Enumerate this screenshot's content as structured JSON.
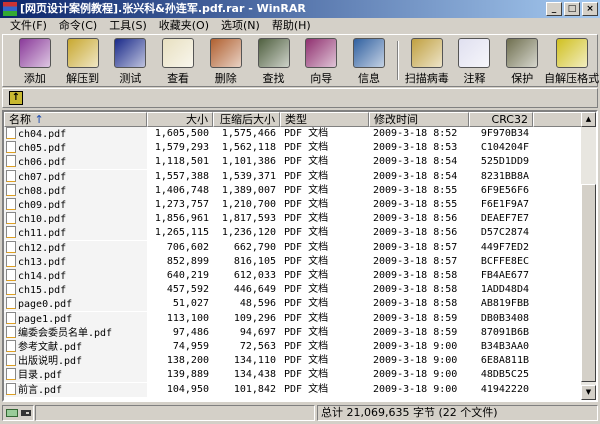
{
  "window": {
    "title": "[网页设计案例教程].张兴科&孙连军.pdf.rar - WinRAR",
    "min": "_",
    "max": "□",
    "close": "×"
  },
  "menu": [
    "文件(F)",
    "命令(C)",
    "工具(S)",
    "收藏夹(O)",
    "选项(N)",
    "帮助(H)"
  ],
  "toolbar": [
    {
      "label": "添加",
      "icon": "add-archive-icon",
      "color": "#8a3a9a"
    },
    {
      "label": "解压到",
      "icon": "extract-to-icon",
      "color": "#c8a830"
    },
    {
      "label": "测试",
      "icon": "test-icon",
      "color": "#1a2a8a"
    },
    {
      "label": "查看",
      "icon": "view-icon",
      "color": "#e8e0c0"
    },
    {
      "label": "删除",
      "icon": "delete-icon",
      "color": "#b06030"
    },
    {
      "label": "查找",
      "icon": "find-icon",
      "color": "#506040"
    },
    {
      "label": "向导",
      "icon": "wizard-icon",
      "color": "#903070"
    },
    {
      "label": "信息",
      "icon": "info-icon",
      "color": "#3060a0"
    },
    {
      "label": "扫描病毒",
      "icon": "virus-scan-icon",
      "color": "#c0a040"
    },
    {
      "label": "注释",
      "icon": "comment-icon",
      "color": "#e0e0f0"
    },
    {
      "label": "保护",
      "icon": "protect-icon",
      "color": "#707050"
    },
    {
      "label": "自解压格式",
      "icon": "sfx-icon",
      "color": "#d0c020"
    }
  ],
  "columns": {
    "name": "名称",
    "size": "大小",
    "packed": "压缩后大小",
    "type": "类型",
    "modified": "修改时间",
    "crc": "CRC32",
    "sort_icon": "↑"
  },
  "files": [
    {
      "name": "ch04.pdf",
      "size": "1,605,500",
      "packed": "1,575,466",
      "type": "PDF 文档",
      "modified": "2009-3-18 8:52",
      "crc": "9F970B34"
    },
    {
      "name": "ch05.pdf",
      "size": "1,579,293",
      "packed": "1,562,118",
      "type": "PDF 文档",
      "modified": "2009-3-18 8:53",
      "crc": "C104204F"
    },
    {
      "name": "ch06.pdf",
      "size": "1,118,501",
      "packed": "1,101,386",
      "type": "PDF 文档",
      "modified": "2009-3-18 8:54",
      "crc": "525D1DD9"
    },
    {
      "name": "ch07.pdf",
      "size": "1,557,388",
      "packed": "1,539,371",
      "type": "PDF 文档",
      "modified": "2009-3-18 8:54",
      "crc": "8231BB8A"
    },
    {
      "name": "ch08.pdf",
      "size": "1,406,748",
      "packed": "1,389,007",
      "type": "PDF 文档",
      "modified": "2009-3-18 8:55",
      "crc": "6F9E56F6"
    },
    {
      "name": "ch09.pdf",
      "size": "1,273,757",
      "packed": "1,210,700",
      "type": "PDF 文档",
      "modified": "2009-3-18 8:55",
      "crc": "F6E1F9A7"
    },
    {
      "name": "ch10.pdf",
      "size": "1,856,961",
      "packed": "1,817,593",
      "type": "PDF 文档",
      "modified": "2009-3-18 8:56",
      "crc": "DEAEF7E7"
    },
    {
      "name": "ch11.pdf",
      "size": "1,265,115",
      "packed": "1,236,120",
      "type": "PDF 文档",
      "modified": "2009-3-18 8:56",
      "crc": "D57C2874"
    },
    {
      "name": "ch12.pdf",
      "size": "706,602",
      "packed": "662,790",
      "type": "PDF 文档",
      "modified": "2009-3-18 8:57",
      "crc": "449F7ED2"
    },
    {
      "name": "ch13.pdf",
      "size": "852,899",
      "packed": "816,105",
      "type": "PDF 文档",
      "modified": "2009-3-18 8:57",
      "crc": "BCFFE8EC"
    },
    {
      "name": "ch14.pdf",
      "size": "640,219",
      "packed": "612,033",
      "type": "PDF 文档",
      "modified": "2009-3-18 8:58",
      "crc": "FB4AE677"
    },
    {
      "name": "ch15.pdf",
      "size": "457,592",
      "packed": "446,649",
      "type": "PDF 文档",
      "modified": "2009-3-18 8:58",
      "crc": "1ADD48D4"
    },
    {
      "name": "page0.pdf",
      "size": "51,027",
      "packed": "48,596",
      "type": "PDF 文档",
      "modified": "2009-3-18 8:58",
      "crc": "AB819FBB"
    },
    {
      "name": "page1.pdf",
      "size": "113,100",
      "packed": "109,296",
      "type": "PDF 文档",
      "modified": "2009-3-18 8:59",
      "crc": "DB0B3408"
    },
    {
      "name": "编委会委员名单.pdf",
      "size": "97,486",
      "packed": "94,697",
      "type": "PDF 文档",
      "modified": "2009-3-18 8:59",
      "crc": "87091B6B"
    },
    {
      "name": "参考文献.pdf",
      "size": "74,959",
      "packed": "72,563",
      "type": "PDF 文档",
      "modified": "2009-3-18 9:00",
      "crc": "B34B3AA0"
    },
    {
      "name": "出版说明.pdf",
      "size": "138,200",
      "packed": "134,110",
      "type": "PDF 文档",
      "modified": "2009-3-18 9:00",
      "crc": "6E8A811B"
    },
    {
      "name": "目录.pdf",
      "size": "139,889",
      "packed": "134,438",
      "type": "PDF 文档",
      "modified": "2009-3-18 9:00",
      "crc": "48DB5C25"
    },
    {
      "name": "前言.pdf",
      "size": "104,950",
      "packed": "101,842",
      "type": "PDF 文档",
      "modified": "2009-3-18 9:00",
      "crc": "41942220"
    }
  ],
  "status": {
    "total": "总计 21,069,635 字节 (22 个文件)"
  }
}
